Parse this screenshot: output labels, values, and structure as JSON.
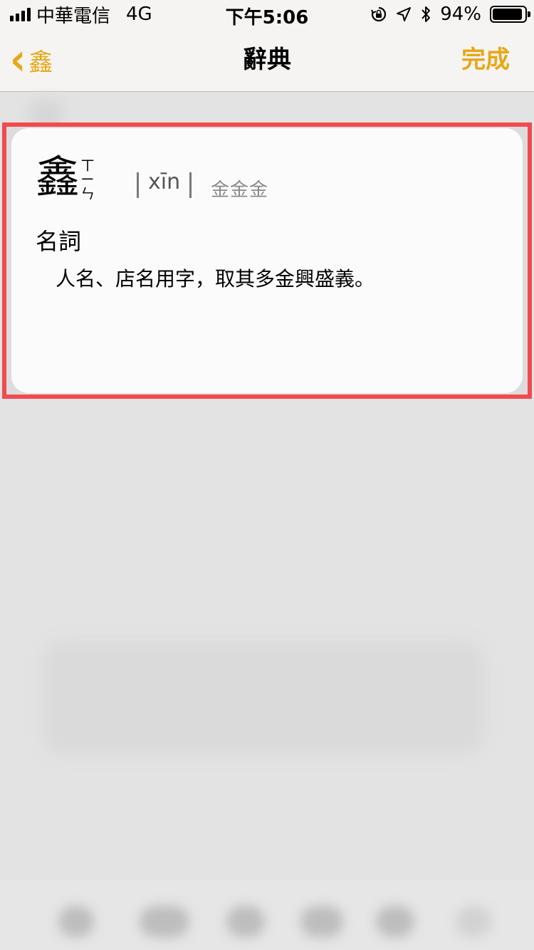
{
  "status_bar": {
    "carrier": "中華電信",
    "network": "4G",
    "time": "下午5:06",
    "battery_percent": "94%",
    "battery_level": 0.94
  },
  "nav": {
    "back_label": "鑫",
    "title": "辭典",
    "done_label": "完成"
  },
  "entry": {
    "headword": "鑫",
    "zhuyin": [
      "ㄒ",
      "ㄧ",
      "ㄣ"
    ],
    "pinyin": "xīn",
    "variants": "金金金",
    "part_of_speech": "名詞",
    "definition": "人名、店名用字，取其多金興盛義。"
  },
  "colors": {
    "accent": "#e7a817",
    "highlight_border": "#f24a4f"
  },
  "icons": {
    "signal": "signal-icon",
    "rotation_lock": "rotation-lock-icon",
    "location": "location-icon",
    "bluetooth": "bluetooth-icon",
    "battery": "battery-icon",
    "back": "chevron-left-icon"
  }
}
